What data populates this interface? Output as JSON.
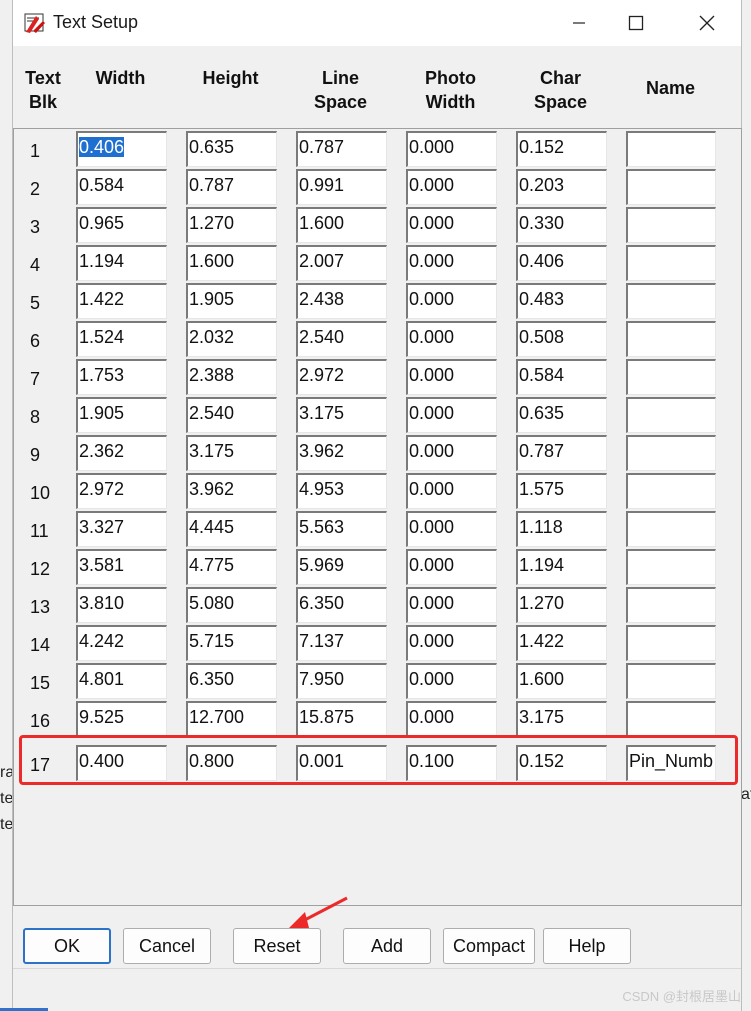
{
  "window": {
    "title": "Text Setup"
  },
  "columns": [
    "Text\nBlk",
    "Width",
    "Height",
    "Line\nSpace",
    "Photo\nWidth",
    "Char\nSpace",
    "Name"
  ],
  "column_lines": [
    [
      "Text",
      "Blk"
    ],
    [
      "Width"
    ],
    [
      "Height"
    ],
    [
      "Line",
      "Space"
    ],
    [
      "Photo",
      "Width"
    ],
    [
      "Char",
      "Space"
    ],
    [
      "Name"
    ]
  ],
  "rows": [
    {
      "blk": "1",
      "width": "0.406",
      "height": "0.635",
      "line_space": "0.787",
      "photo_width": "0.000",
      "char_space": "0.152",
      "name": ""
    },
    {
      "blk": "2",
      "width": "0.584",
      "height": "0.787",
      "line_space": "0.991",
      "photo_width": "0.000",
      "char_space": "0.203",
      "name": ""
    },
    {
      "blk": "3",
      "width": "0.965",
      "height": "1.270",
      "line_space": "1.600",
      "photo_width": "0.000",
      "char_space": "0.330",
      "name": ""
    },
    {
      "blk": "4",
      "width": "1.194",
      "height": "1.600",
      "line_space": "2.007",
      "photo_width": "0.000",
      "char_space": "0.406",
      "name": ""
    },
    {
      "blk": "5",
      "width": "1.422",
      "height": "1.905",
      "line_space": "2.438",
      "photo_width": "0.000",
      "char_space": "0.483",
      "name": ""
    },
    {
      "blk": "6",
      "width": "1.524",
      "height": "2.032",
      "line_space": "2.540",
      "photo_width": "0.000",
      "char_space": "0.508",
      "name": ""
    },
    {
      "blk": "7",
      "width": "1.753",
      "height": "2.388",
      "line_space": "2.972",
      "photo_width": "0.000",
      "char_space": "0.584",
      "name": ""
    },
    {
      "blk": "8",
      "width": "1.905",
      "height": "2.540",
      "line_space": "3.175",
      "photo_width": "0.000",
      "char_space": "0.635",
      "name": ""
    },
    {
      "blk": "9",
      "width": "2.362",
      "height": "3.175",
      "line_space": "3.962",
      "photo_width": "0.000",
      "char_space": "0.787",
      "name": ""
    },
    {
      "blk": "10",
      "width": "2.972",
      "height": "3.962",
      "line_space": "4.953",
      "photo_width": "0.000",
      "char_space": "1.575",
      "name": ""
    },
    {
      "blk": "11",
      "width": "3.327",
      "height": "4.445",
      "line_space": "5.563",
      "photo_width": "0.000",
      "char_space": "1.118",
      "name": ""
    },
    {
      "blk": "12",
      "width": "3.581",
      "height": "4.775",
      "line_space": "5.969",
      "photo_width": "0.000",
      "char_space": "1.194",
      "name": ""
    },
    {
      "blk": "13",
      "width": "3.810",
      "height": "5.080",
      "line_space": "6.350",
      "photo_width": "0.000",
      "char_space": "1.270",
      "name": ""
    },
    {
      "blk": "14",
      "width": "4.242",
      "height": "5.715",
      "line_space": "7.137",
      "photo_width": "0.000",
      "char_space": "1.422",
      "name": ""
    },
    {
      "blk": "15",
      "width": "4.801",
      "height": "6.350",
      "line_space": "7.950",
      "photo_width": "0.000",
      "char_space": "1.600",
      "name": ""
    },
    {
      "blk": "16",
      "width": "9.525",
      "height": "12.700",
      "line_space": "15.875",
      "photo_width": "0.000",
      "char_space": "3.175",
      "name": ""
    },
    {
      "blk": "17",
      "width": "0.400",
      "height": "0.800",
      "line_space": "0.001",
      "photo_width": "0.100",
      "char_space": "0.152",
      "name": "Pin_Numb"
    }
  ],
  "selected_cell": {
    "row": 0,
    "field": "width"
  },
  "highlighted_row": 16,
  "buttons": {
    "ok": "OK",
    "cancel": "Cancel",
    "reset": "Reset",
    "add": "Add",
    "compact": "Compact",
    "help": "Help"
  },
  "background_text": {
    "left_lines": [
      "ra",
      "te",
      "te"
    ],
    "right_line": "ati"
  },
  "watermark": "CSDN @封根居墨山",
  "colors": {
    "highlight": "#ec2a2a",
    "selection": "#1f6fd0",
    "default_button_border": "#2b73c9",
    "arrow": "#ec2a2a"
  },
  "icons": {
    "app": "text-setup-app-icon",
    "minimize": "minimize-icon",
    "maximize": "maximize-icon",
    "close": "close-icon"
  }
}
